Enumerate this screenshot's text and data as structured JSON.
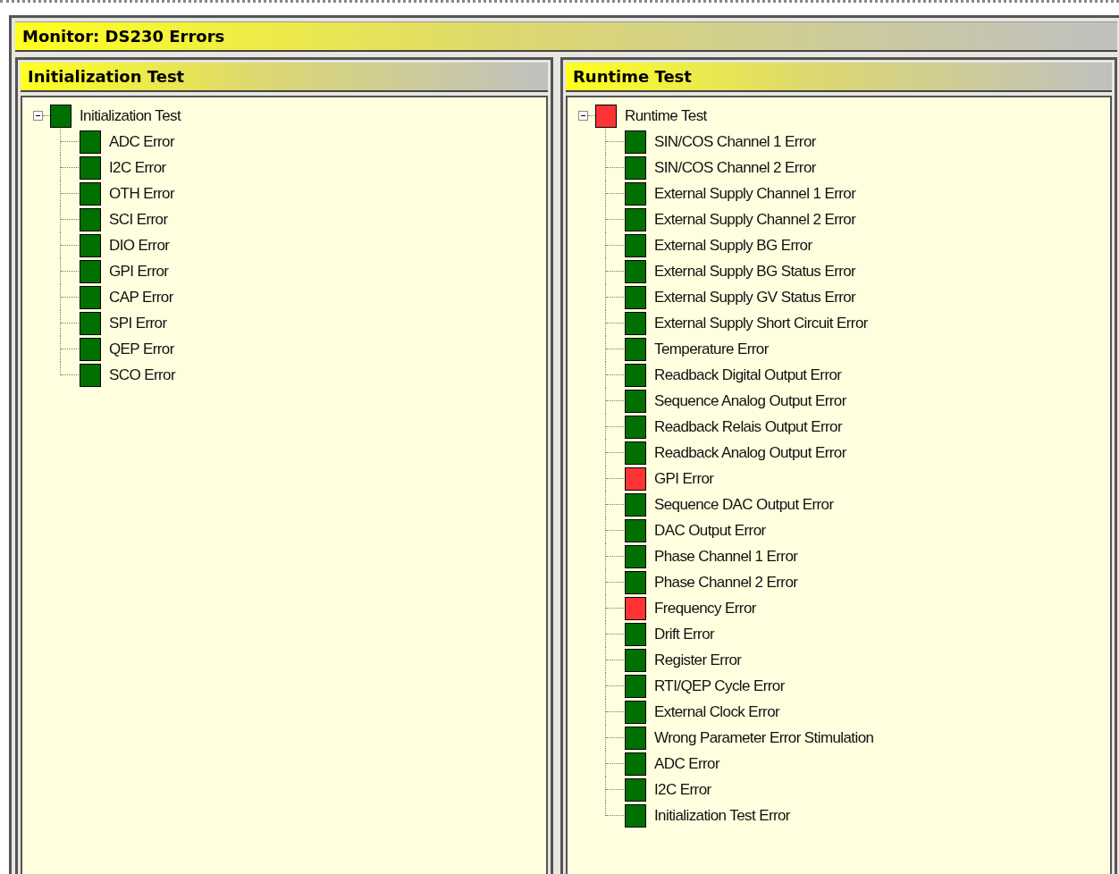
{
  "window": {
    "title": "Monitor: DS230 Errors"
  },
  "panels": [
    {
      "title": "Initialization Test",
      "tree": [
        {
          "label": "Initialization Test",
          "color": "#007000",
          "expanded": true,
          "children": [
            {
              "label": "ADC Error",
              "color": "#007000"
            },
            {
              "label": "I2C Error",
              "color": "#007000"
            },
            {
              "label": "OTH Error",
              "color": "#007000"
            },
            {
              "label": "SCI Error",
              "color": "#007000"
            },
            {
              "label": "DIO Error",
              "color": "#007000"
            },
            {
              "label": "GPI Error",
              "color": "#007000"
            },
            {
              "label": "CAP Error",
              "color": "#007000"
            },
            {
              "label": "SPI Error",
              "color": "#007000"
            },
            {
              "label": "QEP Error",
              "color": "#007000"
            },
            {
              "label": "SCO Error",
              "color": "#007000"
            }
          ]
        }
      ]
    },
    {
      "title": "Runtime Test",
      "tree": [
        {
          "label": "Runtime Test",
          "color": "#ff3333",
          "expanded": true,
          "children": [
            {
              "label": "SIN/COS Channel 1 Error",
              "color": "#007000"
            },
            {
              "label": "SIN/COS Channel 2 Error",
              "color": "#007000"
            },
            {
              "label": "External Supply Channel 1 Error",
              "color": "#007000"
            },
            {
              "label": "External Supply Channel 2 Error",
              "color": "#007000"
            },
            {
              "label": "External Supply BG Error",
              "color": "#007000"
            },
            {
              "label": "External Supply BG Status Error",
              "color": "#007000"
            },
            {
              "label": "External Supply GV Status Error",
              "color": "#007000"
            },
            {
              "label": "External Supply Short Circuit Error",
              "color": "#007000"
            },
            {
              "label": "Temperature Error",
              "color": "#007000"
            },
            {
              "label": "Readback Digital Output Error",
              "color": "#007000"
            },
            {
              "label": "Sequence Analog Output Error",
              "color": "#007000"
            },
            {
              "label": "Readback Relais Output Error",
              "color": "#007000"
            },
            {
              "label": "Readback Analog Output Error",
              "color": "#007000"
            },
            {
              "label": "GPI Error",
              "color": "#ff3333"
            },
            {
              "label": "Sequence DAC Output Error",
              "color": "#007000"
            },
            {
              "label": "DAC Output Error",
              "color": "#007000"
            },
            {
              "label": "Phase Channel 1 Error",
              "color": "#007000"
            },
            {
              "label": "Phase Channel 2 Error",
              "color": "#007000"
            },
            {
              "label": "Frequency Error",
              "color": "#ff3333"
            },
            {
              "label": "Drift Error",
              "color": "#007000"
            },
            {
              "label": "Register Error",
              "color": "#007000"
            },
            {
              "label": "RTI/QEP Cycle Error",
              "color": "#007000"
            },
            {
              "label": "External Clock Error",
              "color": "#007000"
            },
            {
              "label": "Wrong Parameter Error Stimulation",
              "color": "#007000"
            },
            {
              "label": "ADC Error",
              "color": "#007000"
            },
            {
              "label": "I2C Error",
              "color": "#007000"
            },
            {
              "label": "Initialization Test Error",
              "color": "#007000"
            }
          ]
        }
      ]
    }
  ]
}
